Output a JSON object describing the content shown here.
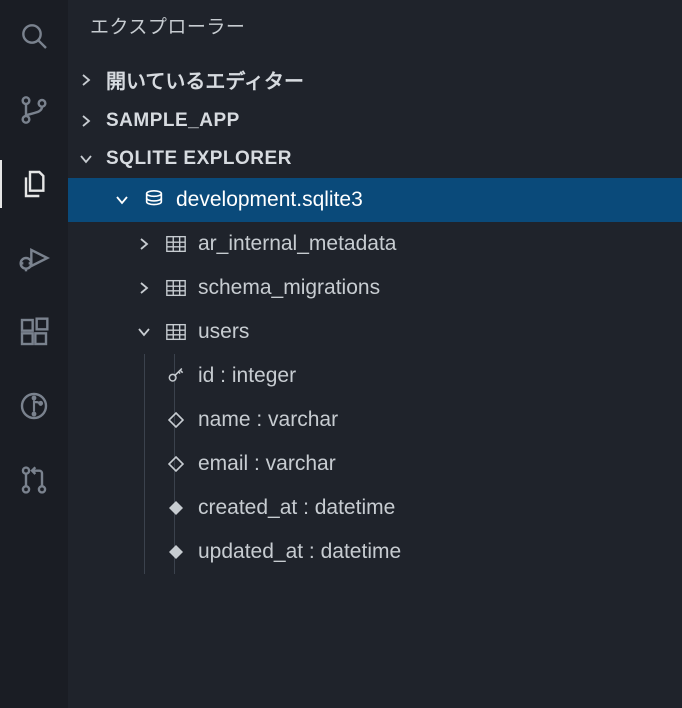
{
  "sidebar": {
    "title": "エクスプローラー",
    "sections": {
      "open_editors": {
        "label": "開いているエディター"
      },
      "workspace": {
        "label": "SAMPLE_APP"
      },
      "sqlite": {
        "label": "SQLITE EXPLORER"
      }
    }
  },
  "sqlite": {
    "database": {
      "name": "development.sqlite3"
    },
    "tables": [
      {
        "name": "ar_internal_metadata",
        "expanded": false
      },
      {
        "name": "schema_migrations",
        "expanded": false
      },
      {
        "name": "users",
        "expanded": true
      }
    ],
    "users_columns": [
      {
        "icon": "key",
        "label": "id : integer"
      },
      {
        "icon": "diamond",
        "label": "name : varchar"
      },
      {
        "icon": "diamond",
        "label": "email : varchar"
      },
      {
        "icon": "solid",
        "label": "created_at : datetime"
      },
      {
        "icon": "solid",
        "label": "updated_at : datetime"
      }
    ]
  }
}
